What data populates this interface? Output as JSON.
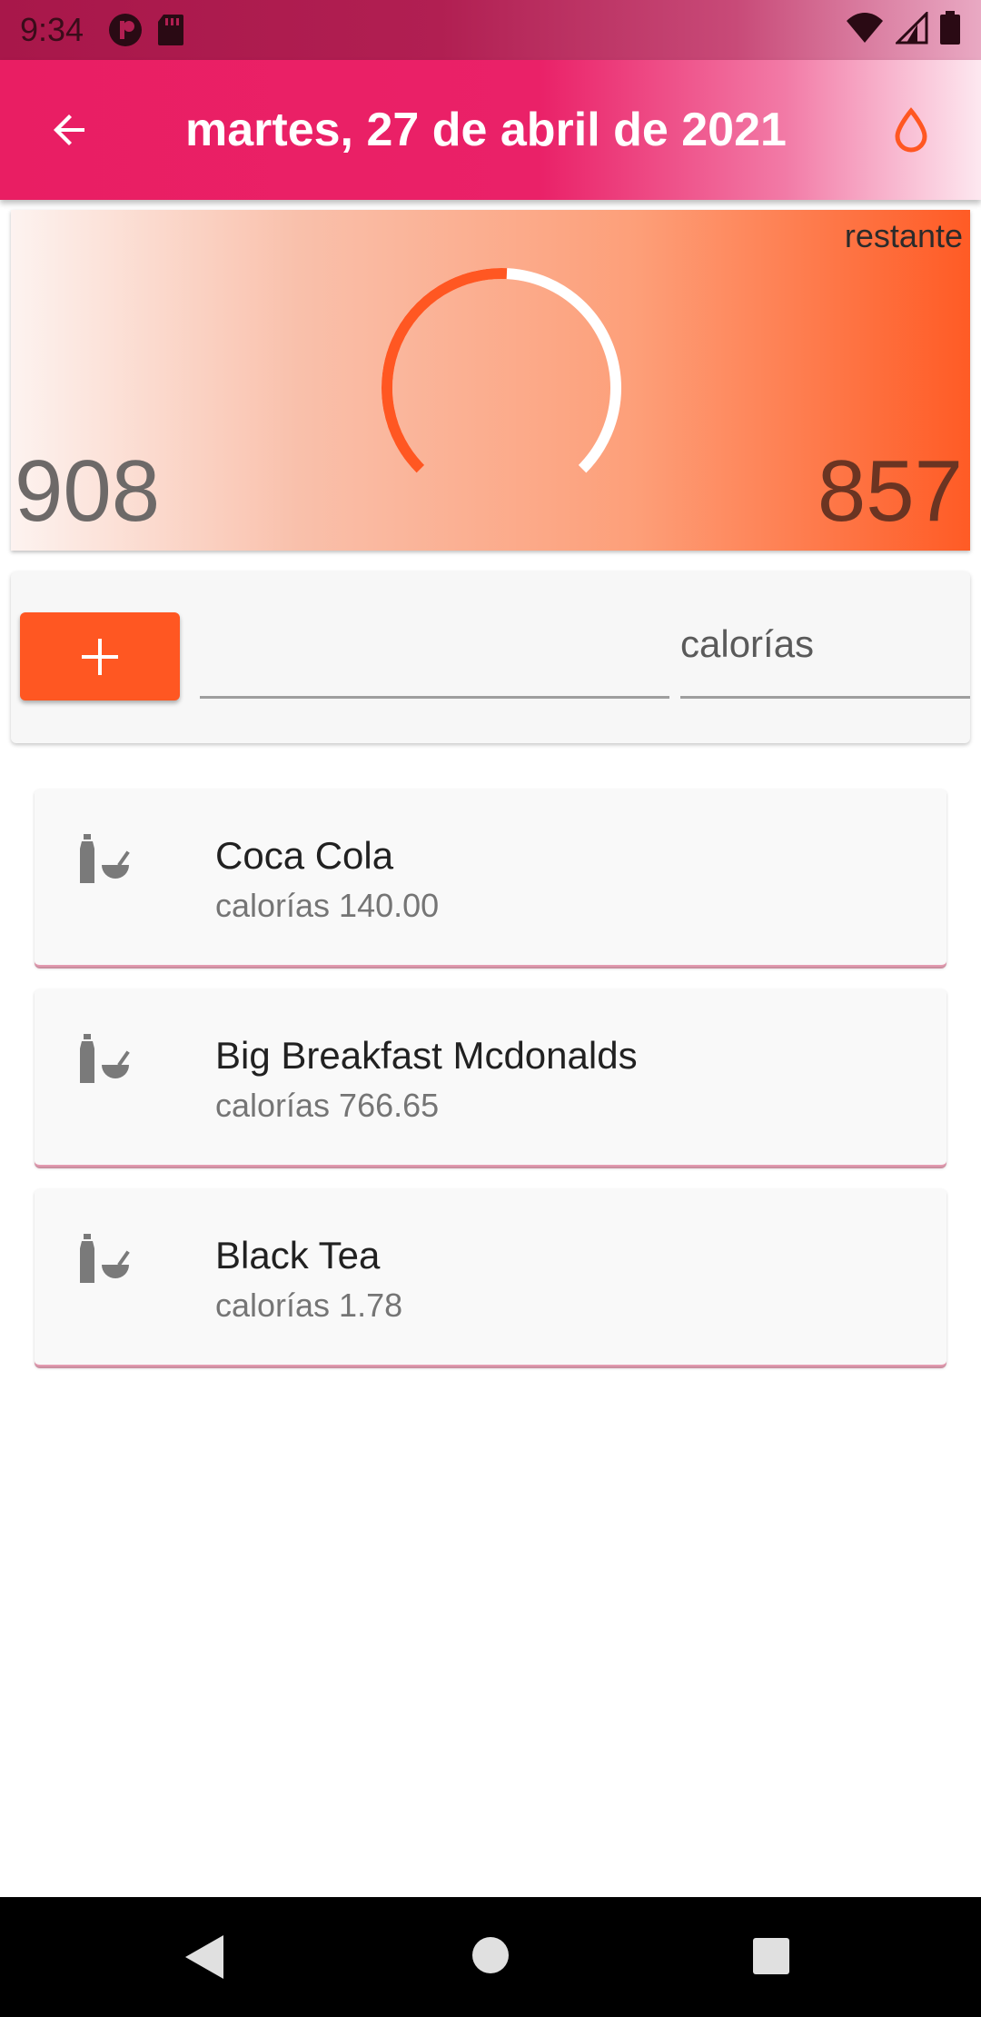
{
  "status_bar": {
    "time": "9:34"
  },
  "app_bar": {
    "title": "martes, 27 de abril de 2021"
  },
  "summary": {
    "remaining_label": "restante",
    "consumed": "908",
    "remaining": "857",
    "progress_fraction": 0.51
  },
  "add_form": {
    "calories_label": "calorías"
  },
  "food_items": [
    {
      "name": "Coca Cola",
      "calories_text": "calorías 140.00"
    },
    {
      "name": "Big Breakfast Mcdonalds",
      "calories_text": "calorías 766.65"
    },
    {
      "name": "Black Tea",
      "calories_text": "calorías 1.78"
    }
  ],
  "colors": {
    "primary": "#e91e63",
    "accent": "#ff5722"
  }
}
